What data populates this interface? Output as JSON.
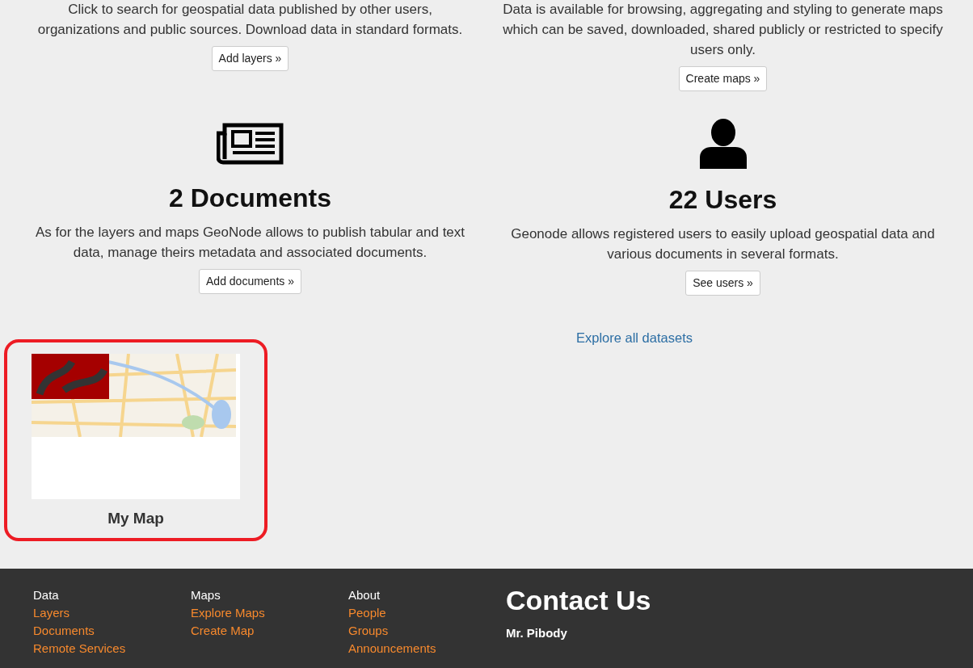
{
  "features_top": [
    {
      "description": "Click to search for geospatial data published by other users, organizations and public sources. Download data in standard formats.",
      "button": "Add layers »"
    },
    {
      "description": "Data is available for browsing, aggregating and styling to generate maps which can be saved, downloaded, shared publicly or restricted to specify users only.",
      "button": "Create maps »"
    }
  ],
  "features": [
    {
      "title": "2 Documents",
      "description": "As for the layers and maps GeoNode allows to publish tabular and text data, manage theirs metadata and associated documents.",
      "button": "Add documents »"
    },
    {
      "title": "22 Users",
      "description": "Geonode allows registered users to easily upload geospatial data and various documents in several formats.",
      "button": "See users »"
    }
  ],
  "explore_link": "Explore all datasets",
  "cards": [
    {
      "kind": "picture",
      "title": "My Map",
      "highlighted": true
    }
  ],
  "footer": {
    "columns": [
      {
        "heading": "Data",
        "links": [
          "Layers",
          "Documents",
          "Remote Services"
        ]
      },
      {
        "heading": "Maps",
        "links": [
          "Explore Maps",
          "Create Map"
        ]
      },
      {
        "heading": "About",
        "links": [
          "People",
          "Groups",
          "Announcements"
        ]
      }
    ],
    "contact": {
      "title": "Contact Us",
      "name": "Mr. Pibody"
    }
  }
}
